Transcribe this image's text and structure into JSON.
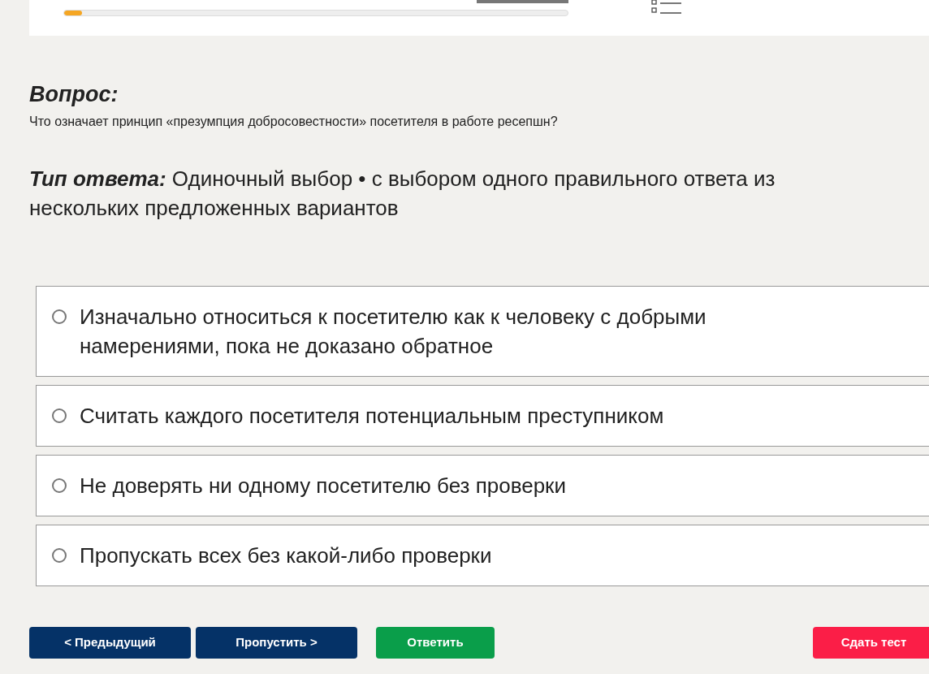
{
  "header": {
    "progress": {
      "level": 0.035
    }
  },
  "question": {
    "label": "Вопрос:",
    "text": "Что означает принцип «презумпция добросовестности» посетителя в работе ресепшн?"
  },
  "answer_type": {
    "text": "**Тип ответа:** Одиночный выбор • с выбором одного правильного ответа из нескольких предложенных вариантов"
  },
  "options": [
    {
      "text": "Изначально относиться к посетителю как к человеку с добрыми намерениями, пока не доказано обратное",
      "selected": false
    },
    {
      "text": "Считать каждого посетителя потенциальным преступником",
      "selected": false
    },
    {
      "text": "Не доверять ни одному посетителю без проверки",
      "selected": false
    },
    {
      "text": "Пропускать всех без какой-либо проверки",
      "selected": false
    }
  ],
  "buttons": [
    {
      "label": "< Предыдущий",
      "kind": "nav"
    },
    {
      "label": "Пропустить >",
      "kind": "nav"
    },
    {
      "label": "Ответить",
      "kind": "answer"
    },
    {
      "label": "Сдать тест",
      "kind": "finish"
    }
  ]
}
